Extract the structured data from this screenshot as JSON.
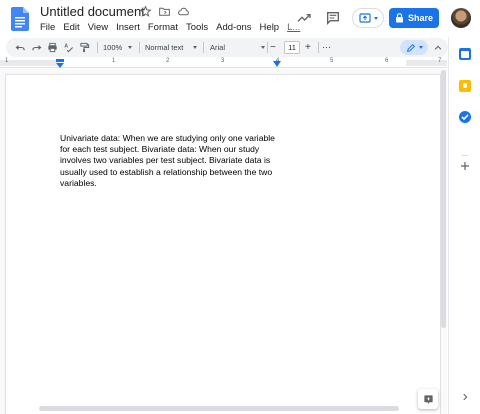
{
  "document": {
    "title": "Untitled document",
    "menu": [
      "File",
      "Edit",
      "View",
      "Insert",
      "Format",
      "Tools",
      "Add-ons",
      "Help",
      "L..."
    ],
    "body_text": "Univariate data: When we are studying only one variable for each test subject.  Bivariate data: When our study involves two variables per test subject. Bivariate data is usually used to establish a relationship between the two variables."
  },
  "header": {
    "share_label": "Share",
    "icons": [
      "star-icon",
      "move-folder-icon",
      "cloud-status-icon",
      "activity-trend-icon",
      "comments-icon",
      "present-icon"
    ]
  },
  "toolbar": {
    "zoom": "100%",
    "style": "Normal text",
    "font": "Arial",
    "font_size": "11",
    "minus": "−",
    "plus": "+",
    "more": "⋯"
  },
  "ruler": {
    "numbers": [
      "1",
      "1",
      "2",
      "3",
      "4",
      "5",
      "6",
      "7"
    ]
  },
  "colors": {
    "accent": "#1a73e8",
    "doc_blue": "#4285f4",
    "keep_yellow": "#fbbc04",
    "calendar_blue": "#1a73e8",
    "tasks_blue": "#1a73e8"
  }
}
